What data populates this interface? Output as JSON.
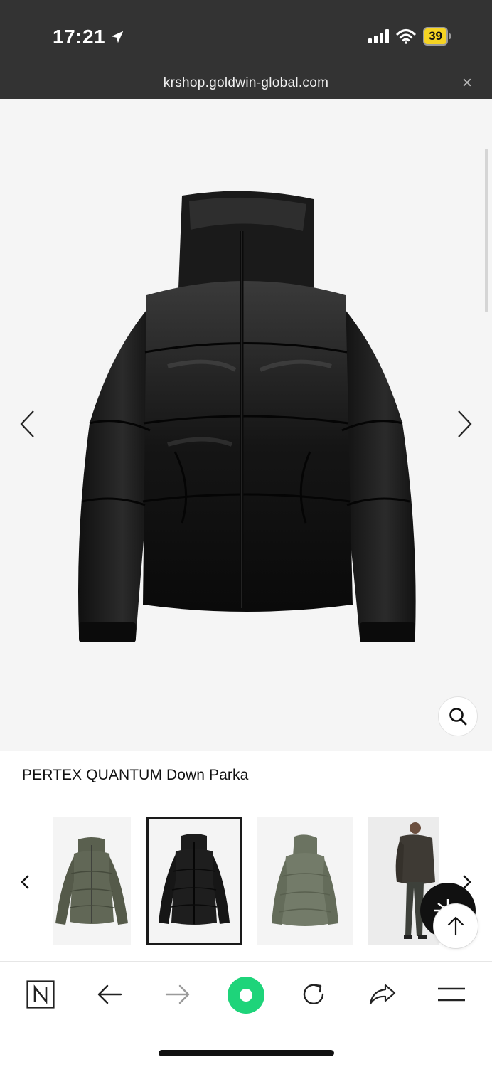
{
  "status_bar": {
    "time": "17:21",
    "battery": "39"
  },
  "browser": {
    "url": "krshop.goldwin-global.com",
    "close": "×"
  },
  "product": {
    "title": "PERTEX QUANTUM Down Parka"
  },
  "icons": {
    "location": "location-arrow-icon",
    "signal": "cellular-signal-icon",
    "wifi": "wifi-icon",
    "battery": "battery-icon",
    "zoom": "magnifier-icon",
    "back_to_top": "arrow-up-icon",
    "brand": "goldwin-logo-icon"
  },
  "colors": {
    "status_bg": "#333333",
    "battery_accent": "#f5d323",
    "record_button": "#1ed47a",
    "image_bg": "#f5f5f5"
  },
  "thumbnails": [
    {
      "color_name": "olive"
    },
    {
      "color_name": "black",
      "selected": true
    },
    {
      "color_name": "olive-back"
    },
    {
      "color_name": "model-brown"
    }
  ],
  "toolbar": {
    "items": [
      "naver-icon",
      "back-arrow-icon",
      "forward-arrow-icon",
      "green-dot-icon",
      "reload-icon",
      "share-icon",
      "menu-icon"
    ]
  }
}
